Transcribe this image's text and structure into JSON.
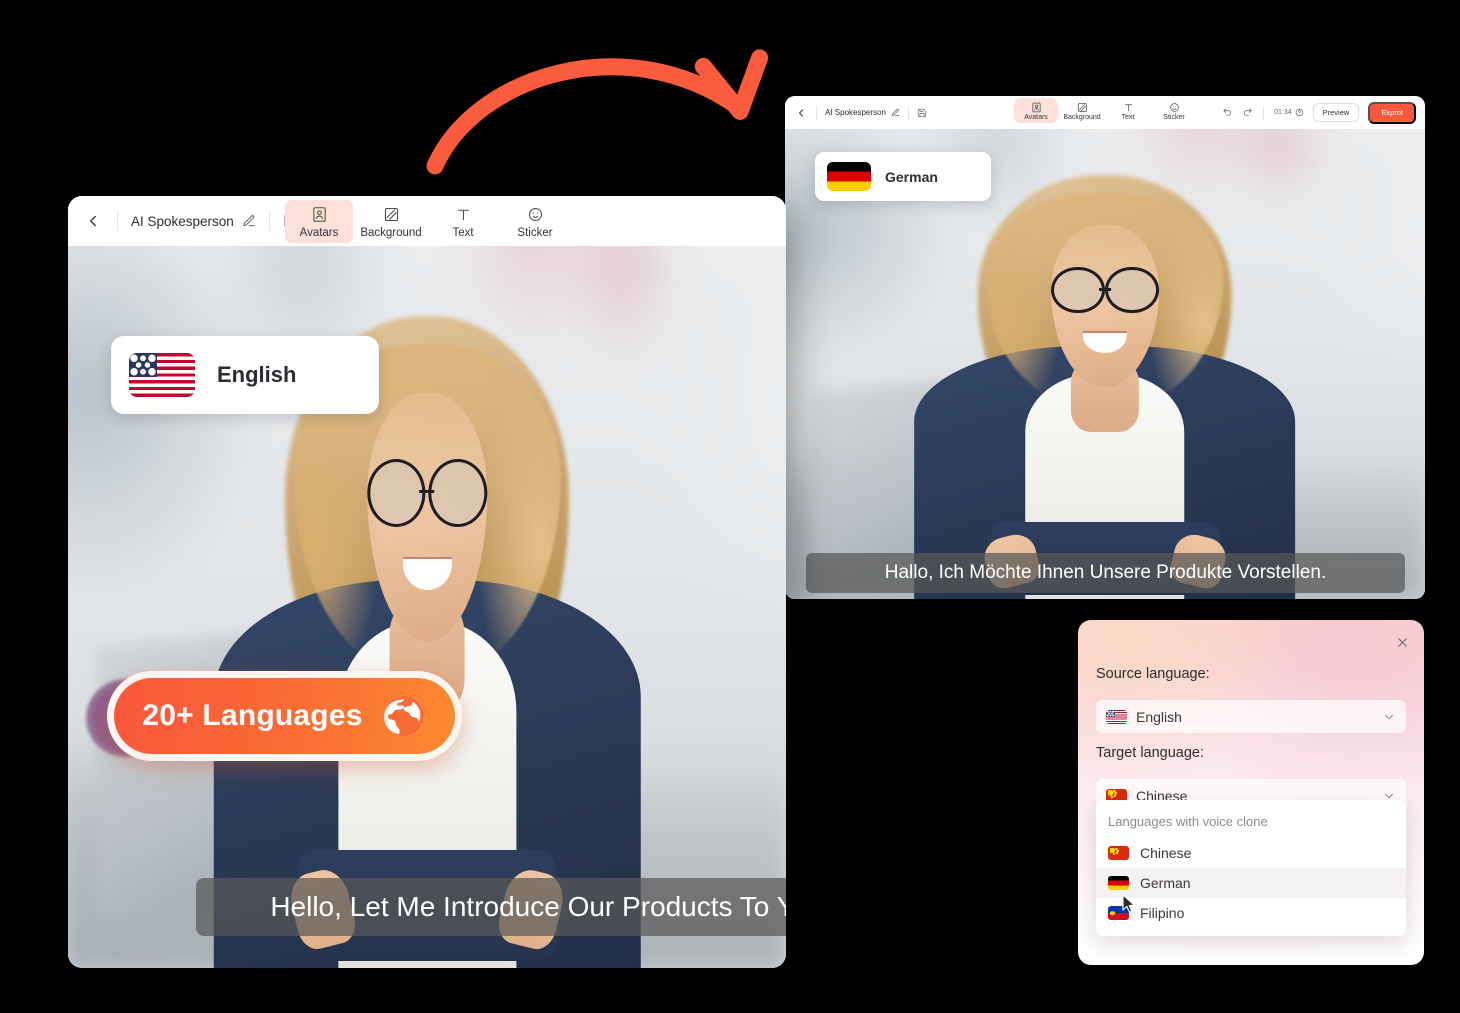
{
  "main_window": {
    "toolbar": {
      "back_icon": "chevron-left-icon",
      "title": "AI Spokesperson",
      "edit_icon": "pencil-icon",
      "save_icon": "save-icon",
      "tabs": [
        {
          "label": "Avatars",
          "icon": "avatar-icon",
          "active": true
        },
        {
          "label": "Background",
          "icon": "background-icon",
          "active": false
        },
        {
          "label": "Text",
          "icon": "text-icon",
          "active": false
        },
        {
          "label": "Sticker",
          "icon": "sticker-icon",
          "active": false
        }
      ]
    },
    "language_chip": {
      "label": "English",
      "flag": "flag-us"
    },
    "caption": "Hello,  Let Me Introduce Our Products To You."
  },
  "second_window": {
    "toolbar": {
      "back_icon": "chevron-left-icon",
      "title": "AI Spokesperson",
      "edit_icon": "pencil-icon",
      "save_icon": "save-icon",
      "tabs": [
        {
          "label": "Avatars",
          "icon": "avatar-icon",
          "active": true
        },
        {
          "label": "Background",
          "icon": "background-icon",
          "active": false
        },
        {
          "label": "Text",
          "icon": "text-icon",
          "active": false
        },
        {
          "label": "Sticker",
          "icon": "sticker-icon",
          "active": false
        }
      ],
      "undo_icon": "undo-icon",
      "redo_icon": "redo-icon",
      "duration": "01:34",
      "help_icon": "help-circle-icon",
      "preview_label": "Preview",
      "export_label": "Exprot"
    },
    "language_chip": {
      "label": "German",
      "flag": "flag-de"
    },
    "caption": "Hallo, Ich Möchte Ihnen Unsere Produkte Vorstellen."
  },
  "languages_badge": {
    "label": "20+ Languages",
    "icon": "globe-icon",
    "color": "#fa5a3c"
  },
  "flow_arrow": {
    "icon": "curved-arrow-icon",
    "color": "#fb5c3d"
  },
  "translate_panel": {
    "close_icon": "close-icon",
    "source_label": "Source language:",
    "source_value": "English",
    "source_flag": "flag-us",
    "target_label": "Target language:",
    "target_value": "Chinese",
    "target_flag": "flag-cn",
    "chevron_icon": "chevron-down-icon",
    "dropdown": {
      "group_title": "Languages with voice clone",
      "options": [
        {
          "label": "Chinese",
          "flag": "flag-cn",
          "hover": false
        },
        {
          "label": "German",
          "flag": "flag-de",
          "hover": true
        },
        {
          "label": "Filipino",
          "flag": "flag-ph",
          "hover": false
        }
      ]
    }
  },
  "cursor": {
    "icon": "mouse-pointer-icon"
  }
}
